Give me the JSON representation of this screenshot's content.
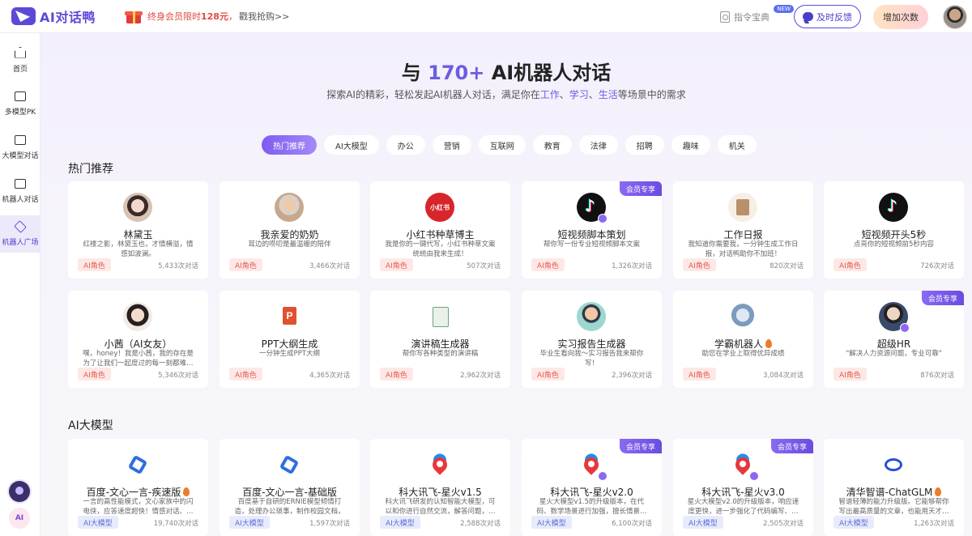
{
  "brand": {
    "name": "AI对话鸭"
  },
  "promo": {
    "text": "终身会员限时",
    "price": "128元",
    "sep": "，",
    "cta": "戳我抢购>>"
  },
  "header": {
    "commands": "指令宝典",
    "new_badge": "NEW",
    "feedback": "及时反馈",
    "add_count": "增加次数"
  },
  "sidebar": {
    "items": [
      {
        "label": "首页",
        "icon": "home-icon"
      },
      {
        "label": "多模型PK",
        "icon": "compare-icon"
      },
      {
        "label": "大模型对话",
        "icon": "monitor-icon"
      },
      {
        "label": "机器人对话",
        "icon": "chat-icon"
      },
      {
        "label": "机器人广场",
        "icon": "cube-icon"
      }
    ],
    "ai_label": "AI"
  },
  "hero": {
    "title_pre": "与 ",
    "title_num": "170+",
    "title_post": " AI机器人对话",
    "sub_pre": "探索AI的精彩，轻松发起AI机器人对话，满足你在",
    "sub_h1": "工作",
    "sub_sep1": "、",
    "sub_h2": "学习",
    "sub_sep2": "、",
    "sub_h3": "生活",
    "sub_post": "等场景中的需求"
  },
  "categories": [
    "热门推荐",
    "AI大模型",
    "办公",
    "营销",
    "互联网",
    "教育",
    "法律",
    "招聘",
    "趣味",
    "机关"
  ],
  "sections": {
    "hot": "热门推荐",
    "models": "AI大模型"
  },
  "vip_label": "会员专享",
  "hot_cards": [
    {
      "name": "林黛玉",
      "desc": "红楼之影，林黛玉也，才情横溢，情感如波澜。",
      "tag": "AI角色",
      "count": "5,433次对话"
    },
    {
      "name": "我亲爱的奶奶",
      "desc": "耳边的唠叨是最温暖的陪伴",
      "tag": "AI角色",
      "count": "3,466次对话"
    },
    {
      "name": "小红书种草博主",
      "desc": "我是你的一键代写，小红书种草文案统统由我来生成！",
      "tag": "AI角色",
      "count": "507次对话",
      "avatar_text": "小红书"
    },
    {
      "name": "短视频脚本策划",
      "desc": "帮你写一份专业短视频脚本文案",
      "tag": "AI角色",
      "count": "1,326次对话"
    },
    {
      "name": "工作日报",
      "desc": "我知道你需要我，一分钟生成工作日报，对话鸭助你不加班！",
      "tag": "AI角色",
      "count": "820次对话"
    },
    {
      "name": "短视频开头5秒",
      "desc": "点亮你的短视频前5秒内容",
      "tag": "AI角色",
      "count": "726次对话"
    },
    {
      "name": "小茜（AI女友）",
      "desc": "嘿，honey！我是小茜，我的存在是为了让我们一起度过的每一刻都难…",
      "tag": "AI角色",
      "count": "5,346次对话"
    },
    {
      "name": "PPT大纲生成",
      "desc": "一分钟生成PPT大纲",
      "tag": "AI角色",
      "count": "4,365次对话"
    },
    {
      "name": "演讲稿生成器",
      "desc": "帮你写各种类型的演讲稿",
      "tag": "AI角色",
      "count": "2,962次对话"
    },
    {
      "name": "实习报告生成器",
      "desc": "毕业生看向我～实习报告我来帮你写！",
      "tag": "AI角色",
      "count": "2,396次对话"
    },
    {
      "name": "学霸机器人",
      "desc": "助您在学业上取得优异成绩",
      "tag": "AI角色",
      "count": "3,084次对话"
    },
    {
      "name": "超级HR",
      "desc": "\"解决人力资源问题，专业可靠\"",
      "tag": "AI角色",
      "count": "876次对话"
    }
  ],
  "model_cards": [
    {
      "name": "百度-文心一言-疾速版",
      "desc": "一言的高性能模式，文心家族中的闪电侠，应答速度超快！情感对话、…",
      "tag": "AI大模型",
      "count": "19,740次对话"
    },
    {
      "name": "百度-文心一言-基础版",
      "desc": "百度基于自研的ERNIE模型倾情打造，处理办公琐事，制作校园文档，找…",
      "tag": "AI大模型",
      "count": "1,597次对话"
    },
    {
      "name": "科大讯飞-星火v1.5",
      "desc": "科大讯飞研发的认知智能大模型，可以和你进行自然交流，解答问题，…",
      "tag": "AI大模型",
      "count": "2,588次对话"
    },
    {
      "name": "科大讯飞-星火v2.0",
      "desc": "星火大模型v1.5的升级版本，在代码、数学场景进行加强，擅长情景…",
      "tag": "AI大模型",
      "count": "6,100次对话"
    },
    {
      "name": "科大讯飞-星火v3.0",
      "desc": "星火大模型v2.0的升级版本，响应速度更快，进一步强化了代码编写、…",
      "tag": "AI大模型",
      "count": "2,505次对话"
    },
    {
      "name": "清华智谱-ChatGLM",
      "desc": "智谱轻薄的能力升级版。它能够帮你写出最高质量的文章，也能用天才…",
      "tag": "AI大模型",
      "count": "1,263次对话"
    }
  ]
}
